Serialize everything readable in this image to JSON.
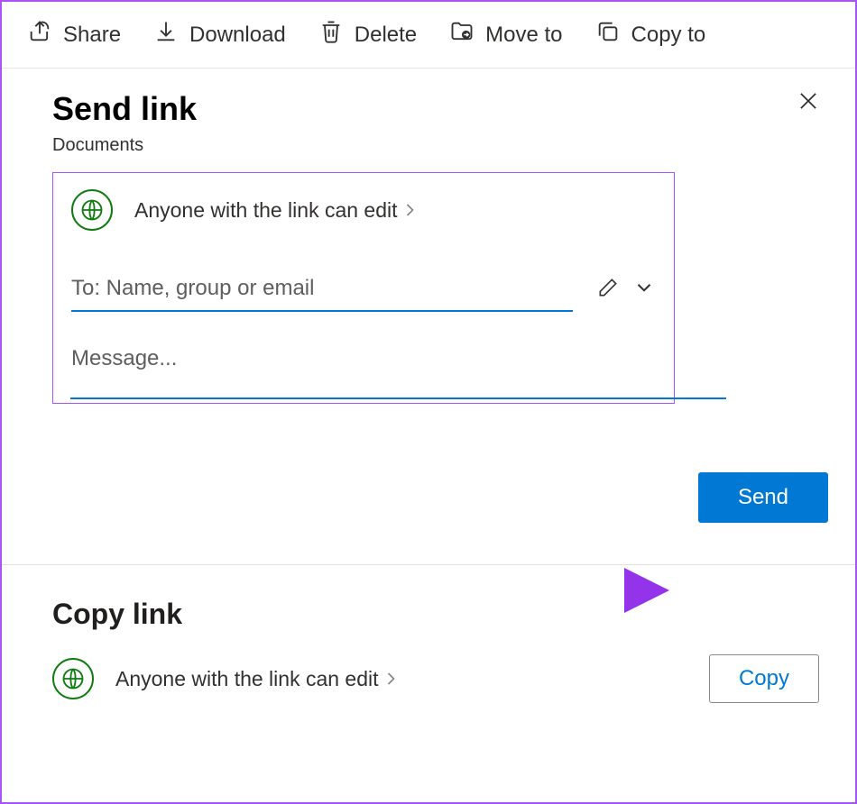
{
  "toolbar": {
    "share": "Share",
    "download": "Download",
    "delete": "Delete",
    "move_to": "Move to",
    "copy_to": "Copy to"
  },
  "dialog": {
    "title": "Send link",
    "subtitle": "Documents",
    "permission_text": "Anyone with the link can edit",
    "to_placeholder": "To: Name, group or email",
    "message_placeholder": "Message...",
    "send_label": "Send"
  },
  "copy": {
    "title": "Copy link",
    "permission_text": "Anyone with the link can edit",
    "copy_label": "Copy"
  }
}
